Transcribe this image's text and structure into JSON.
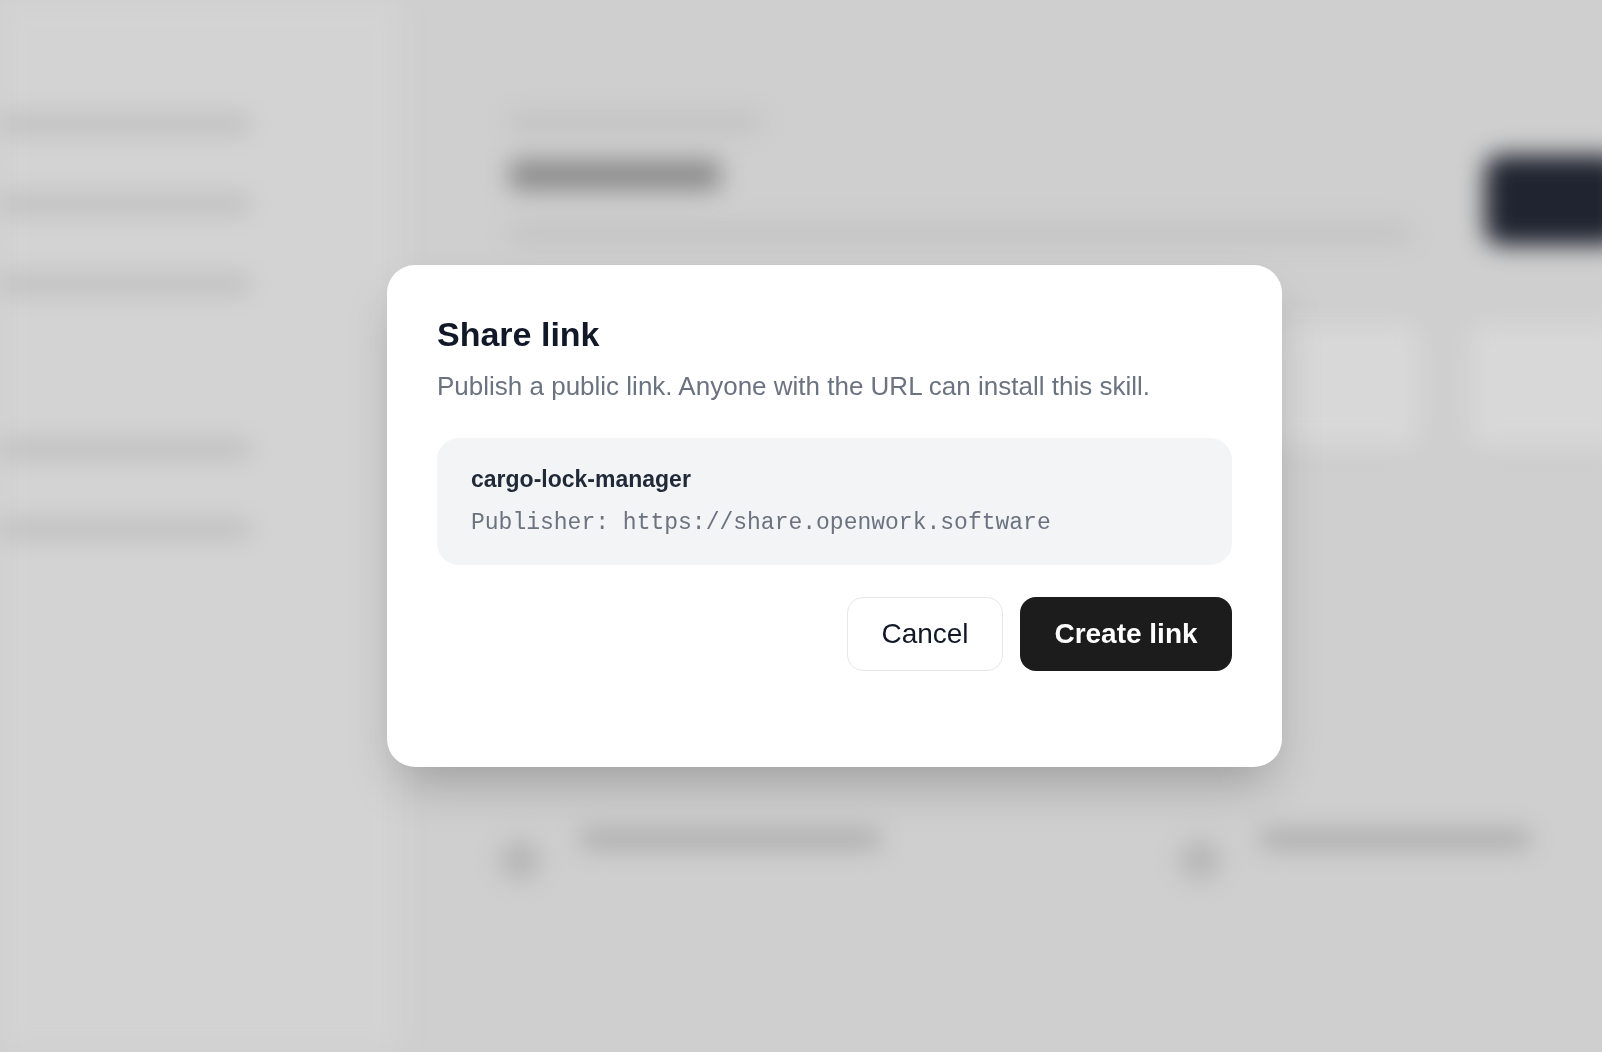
{
  "dialog": {
    "title": "Share link",
    "description": "Publish a public link. Anyone with the URL can install this skill.",
    "item": {
      "name": "cargo-lock-manager",
      "publisher": "Publisher: https://share.openwork.software"
    },
    "buttons": [
      {
        "label": "Cancel",
        "kind": "secondary"
      },
      {
        "label": "Create link",
        "kind": "primary"
      }
    ]
  }
}
